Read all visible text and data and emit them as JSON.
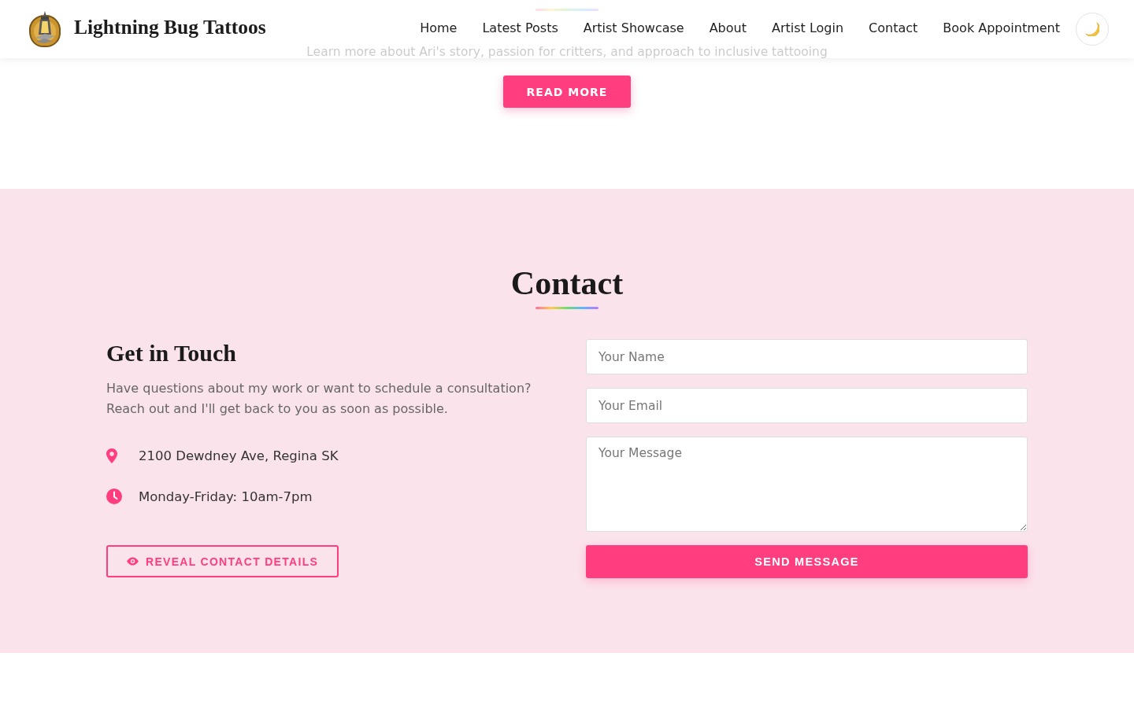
{
  "header": {
    "brand": "Lightning Bug Tattoos",
    "nav": [
      "Home",
      "Latest Posts",
      "Artist Showcase",
      "About",
      "Artist Login",
      "Contact",
      "Book Appointment"
    ]
  },
  "about_teaser": {
    "text": "Learn more about Ari's story, passion for critters, and approach to inclusive tattooing",
    "button": "READ MORE"
  },
  "contact": {
    "title": "Contact",
    "info": {
      "title": "Get in Touch",
      "text": "Have questions about my work or want to schedule a consultation? Reach out and I'll get back to you as soon as possible.",
      "items": [
        {
          "kind": "address",
          "text": "2100 Dewdney Ave, Regina SK"
        },
        {
          "kind": "hours",
          "text": "Monday-Friday: 10am-7pm"
        }
      ],
      "reveal_button": "REVEAL CONTACT DETAILS"
    },
    "form": {
      "fields": [
        {
          "kind": "input",
          "placeholder": "Your Name"
        },
        {
          "kind": "input",
          "placeholder": "Your Email"
        },
        {
          "kind": "textarea",
          "placeholder": "Your Message"
        }
      ],
      "submit": "SEND MESSAGE"
    }
  }
}
